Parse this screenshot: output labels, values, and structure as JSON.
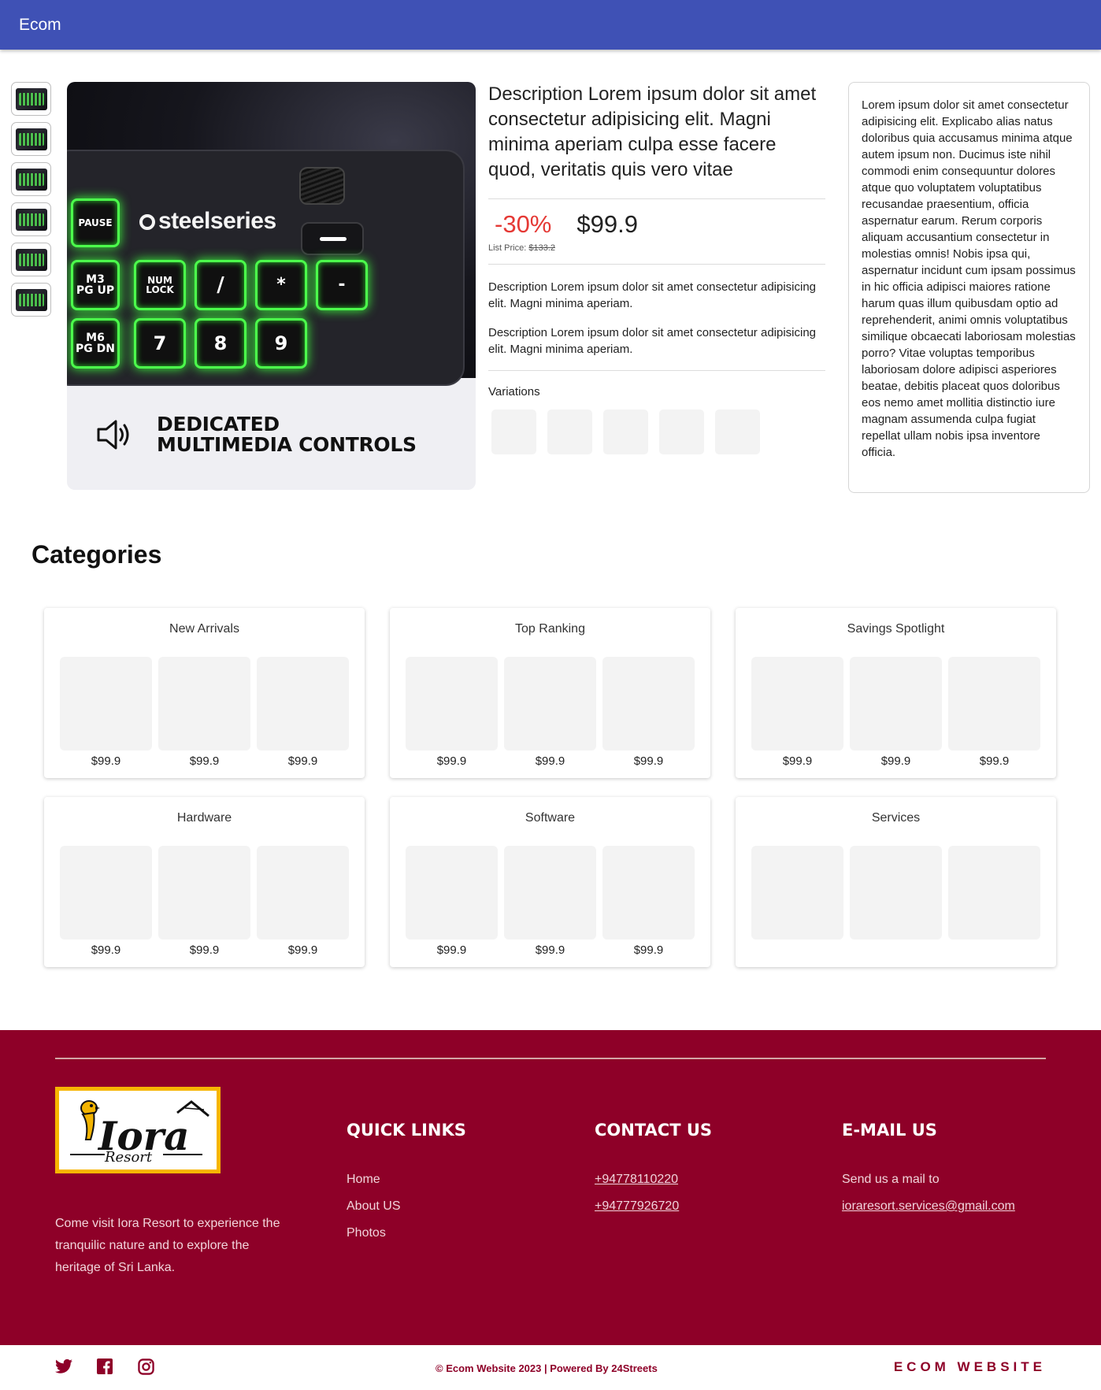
{
  "appbar": {
    "brand": "Ecom"
  },
  "product": {
    "thumbnails": [
      "keyboard-thumb",
      "keyboard-thumb",
      "keyboard-thumb",
      "keyboard-thumb",
      "keyboard-thumb",
      "keyboard-thumb"
    ],
    "hero": {
      "brand_logo": "steelseries",
      "keys": [
        "PAUSE",
        "M3\nPG UP",
        "NUM\nLOCK",
        "/",
        "*",
        "-",
        "M6\nPG DN",
        "7",
        "8",
        "9"
      ],
      "caption_line1": "DEDICATED",
      "caption_line2": "MULTIMEDIA CONTROLS"
    },
    "title": "Description Lorem ipsum dolor sit amet consectetur adipisicing elit. Magni minima aperiam culpa esse facere quod, veritatis quis vero vitae",
    "discount": "-30%",
    "price": "$99.9",
    "list_price_label": "List Price:",
    "list_price": "$133.2",
    "desc1": "Description Lorem ipsum dolor sit amet consectetur adipisicing elit. Magni minima aperiam.",
    "desc2": "Description Lorem ipsum dolor sit amet consectetur adipisicing elit. Magni minima aperiam.",
    "variations_label": "Variations",
    "variation_count": 5,
    "side_text": "Lorem ipsum dolor sit amet consectetur adipisicing elit. Explicabo alias natus doloribus quia accusamus minima atque autem ipsum non. Ducimus iste nihil commodi enim consequuntur dolores atque quo voluptatem voluptatibus recusandae praesentium, officia aspernatur earum. Rerum corporis aliquam accusantium consectetur in molestias omnis! Nobis ipsa qui, aspernatur incidunt cum ipsam possimus in hic officia adipisci maiores ratione harum quas illum quibusdam optio ad reprehenderit, animi omnis voluptatibus similique obcaecati laboriosam molestias porro? Vitae voluptas temporibus laboriosam dolore adipisci asperiores beatae, debitis placeat quos doloribus eos nemo amet mollitia distinctio iure magnam assumenda culpa fugiat repellat ullam nobis ipsa inventore officia."
  },
  "categories": {
    "title": "Categories",
    "cards": [
      {
        "name": "New Arrivals",
        "prices": [
          "$99.9",
          "$99.9",
          "$99.9"
        ]
      },
      {
        "name": "Top Ranking",
        "prices": [
          "$99.9",
          "$99.9",
          "$99.9"
        ]
      },
      {
        "name": "Savings Spotlight",
        "prices": [
          "$99.9",
          "$99.9",
          "$99.9"
        ]
      },
      {
        "name": "Hardware",
        "prices": [
          "$99.9",
          "$99.9",
          "$99.9"
        ]
      },
      {
        "name": "Software",
        "prices": [
          "$99.9",
          "$99.9",
          "$99.9"
        ]
      },
      {
        "name": "Services",
        "prices": [
          "",
          "",
          ""
        ]
      }
    ]
  },
  "footer": {
    "logo_text": "Iora",
    "logo_subtext": "Resort",
    "about": "Come visit Iora Resort to experience the tranquilic nature and to explore the heritage of Sri Lanka.",
    "quick_links": {
      "title": "QUICK LINKS",
      "items": [
        "Home",
        "About US",
        "Photos"
      ]
    },
    "contact": {
      "title": "CONTACT US",
      "phones": [
        "+94778110220",
        "+94777926720"
      ]
    },
    "email": {
      "title": "E-MAIL US",
      "prompt": "Send us a mail to",
      "address": "ioraresort.services@gmail.com"
    },
    "copyright": "Ecom Website 2023 | Powered By 24Streets",
    "copyright_symbol": "©",
    "site_name": "ECOM WEBSITE",
    "socials": [
      "twitter-icon",
      "facebook-icon",
      "instagram-icon"
    ]
  },
  "colors": {
    "appbar": "#3f51b5",
    "discount": "#e53935",
    "footer": "#8e0028",
    "key_glow": "#4cff4c",
    "logo_border": "#f7b500"
  }
}
